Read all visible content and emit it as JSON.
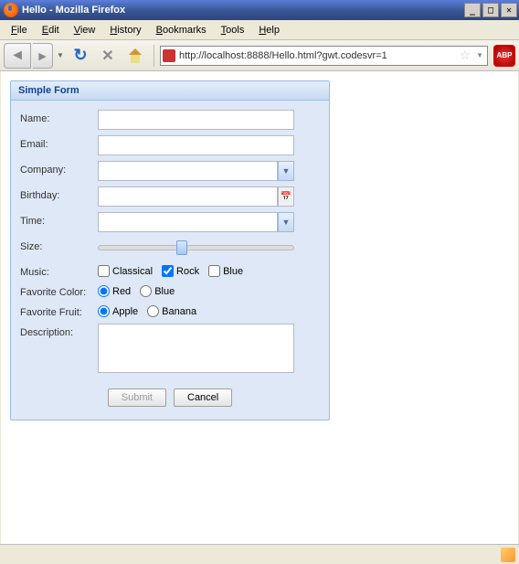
{
  "window": {
    "title": "Hello - Mozilla Firefox"
  },
  "menubar": {
    "file": "File",
    "edit": "Edit",
    "view": "View",
    "history": "History",
    "bookmarks": "Bookmarks",
    "tools": "Tools",
    "help": "Help"
  },
  "toolbar": {
    "url": "http://localhost:8888/Hello.html?gwt.codesvr=1",
    "abp": "ABP"
  },
  "form": {
    "title": "Simple Form",
    "labels": {
      "name": "Name:",
      "email": "Email:",
      "company": "Company:",
      "birthday": "Birthday:",
      "time": "Time:",
      "size": "Size:",
      "music": "Music:",
      "favorite_color": "Favorite Color:",
      "favorite_fruit": "Favorite Fruit:",
      "description": "Description:"
    },
    "values": {
      "name": "",
      "email": "",
      "company": "",
      "birthday": "",
      "time": "",
      "description": ""
    },
    "music": {
      "classical": {
        "label": "Classical",
        "checked": false
      },
      "rock": {
        "label": "Rock",
        "checked": true
      },
      "blue": {
        "label": "Blue",
        "checked": false
      }
    },
    "color": {
      "red": {
        "label": "Red",
        "checked": true
      },
      "blue": {
        "label": "Blue",
        "checked": false
      }
    },
    "fruit": {
      "apple": {
        "label": "Apple",
        "checked": true
      },
      "banana": {
        "label": "Banana",
        "checked": false
      }
    },
    "buttons": {
      "submit": "Submit",
      "cancel": "Cancel"
    }
  }
}
